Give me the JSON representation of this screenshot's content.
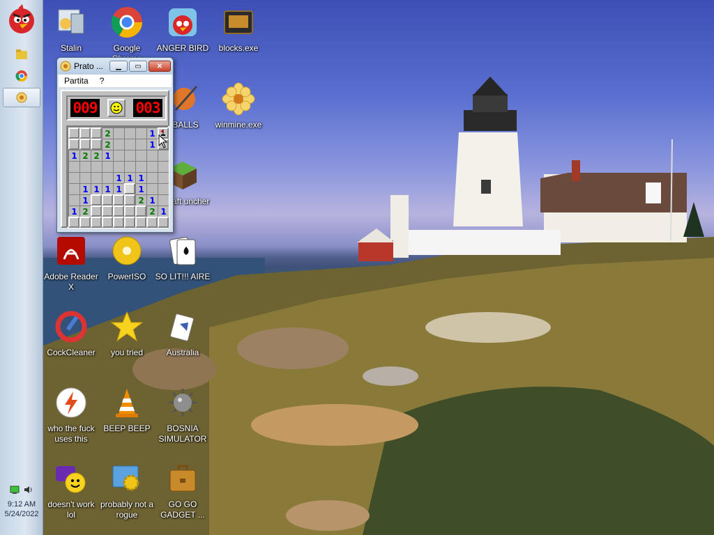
{
  "desktop": {
    "icons": [
      {
        "label": "Stalin",
        "icon": "stalin-icon"
      },
      {
        "label": "Google Chrome",
        "icon": "chrome-icon"
      },
      {
        "label": "ANGER BIRD",
        "icon": "angry-bird-icon"
      },
      {
        "label": "blocks.exe",
        "icon": "blocks-icon"
      },
      {
        "label": "KBALLS",
        "icon": "kballs-icon"
      },
      {
        "label": "winmine.exe",
        "icon": "flower-icon"
      },
      {
        "label": "necraft uncher",
        "icon": "minecraft-icon"
      },
      {
        "label": "Adobe Reader X",
        "icon": "adobe-reader-icon"
      },
      {
        "label": "PowerISO",
        "icon": "poweriso-icon"
      },
      {
        "label": "SO LIT!!! AIRE",
        "icon": "solitaire-icon"
      },
      {
        "label": "CockCleaner",
        "icon": "ccleaner-icon"
      },
      {
        "label": "you tried",
        "icon": "star-icon"
      },
      {
        "label": "Australia",
        "icon": "australia-icon"
      },
      {
        "label": "who the fuck uses this",
        "icon": "flash-icon"
      },
      {
        "label": "BEEP BEEP",
        "icon": "vlc-cone-icon"
      },
      {
        "label": "BOSNIA SIMULATOR",
        "icon": "mine-icon"
      },
      {
        "label": "doesn't work lol",
        "icon": "yahoo-messenger-icon"
      },
      {
        "label": "probably not a rogue",
        "icon": "settings-icon"
      },
      {
        "label": "GO GO GADGET ...",
        "icon": "briefcase-icon"
      }
    ]
  },
  "taskbar": {
    "start_icon": "angry-bird-icon",
    "items": [
      {
        "icon": "explorer-folder-icon",
        "active": false
      },
      {
        "icon": "chrome-icon",
        "active": false
      },
      {
        "icon": "minesweeper-icon",
        "active": true
      }
    ],
    "tray": {
      "time": "9:12 AM",
      "date": "5/24/2022"
    }
  },
  "minesweeper": {
    "title": "Prato ...",
    "menu": [
      "Partita",
      "?"
    ],
    "mines_counter": "009",
    "timer": "003",
    "face": "smiley-face-icon",
    "grid": [
      [
        "u",
        "u",
        "u",
        "2",
        "",
        "",
        "",
        "1",
        "F"
      ],
      [
        "u",
        "u",
        "u",
        "2",
        "",
        "",
        "",
        "1",
        "u"
      ],
      [
        "1",
        "2",
        "2",
        "1",
        "",
        "",
        "",
        "",
        ""
      ],
      [
        "",
        "",
        "",
        "",
        "",
        "",
        "",
        "",
        ""
      ],
      [
        "",
        "",
        "",
        "",
        "1",
        "1",
        "1",
        "",
        ""
      ],
      [
        "",
        "1",
        "1",
        "1",
        "1",
        "o",
        "1",
        "",
        ""
      ],
      [
        "",
        "1",
        "u",
        "u",
        "u",
        "u",
        "2",
        "1",
        ""
      ],
      [
        "1",
        "2",
        "u",
        "u",
        "u",
        "u",
        "u",
        "2",
        "1"
      ],
      [
        "u",
        "u",
        "u",
        "u",
        "u",
        "u",
        "u",
        "u",
        "u"
      ]
    ]
  },
  "colors": {
    "accent": "#3d4fb5",
    "lcd": "#ff0000",
    "one": "#0000ff",
    "two": "#007b00"
  }
}
